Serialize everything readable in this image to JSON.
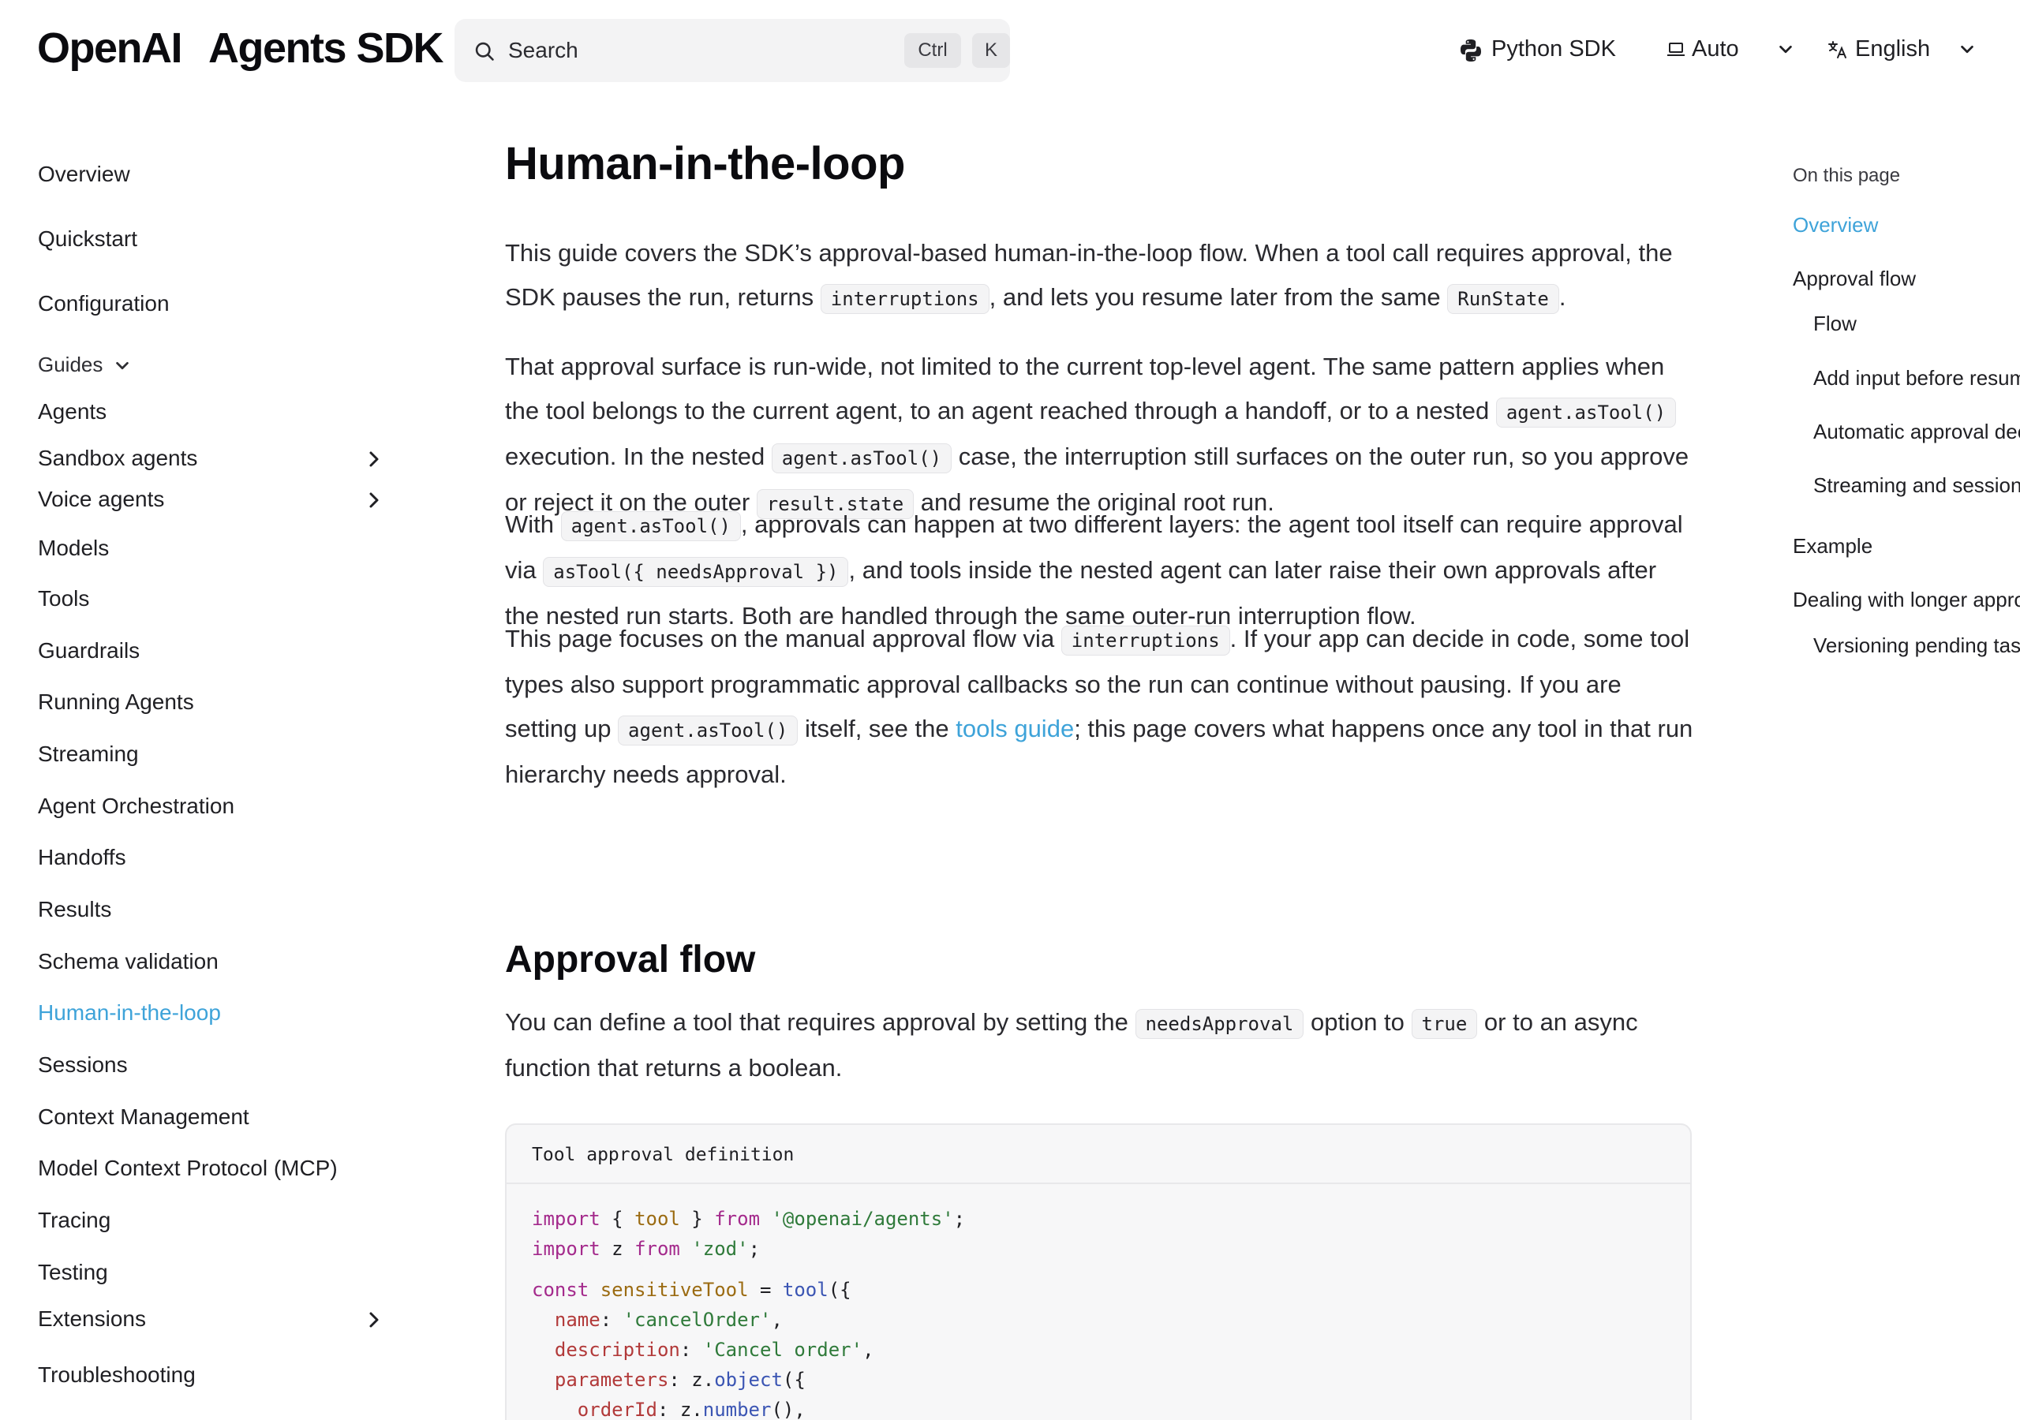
{
  "header": {
    "logo": {
      "brand": "OpenAI",
      "product": "Agents SDK"
    },
    "search": {
      "placeholder": "Search",
      "kbd_ctrl": "Ctrl",
      "kbd_k": "K"
    },
    "python_sdk": "Python SDK",
    "theme": "Auto",
    "language": "English"
  },
  "sidebar": {
    "items": [
      {
        "label": "Overview"
      },
      {
        "label": "Quickstart"
      },
      {
        "label": "Configuration"
      },
      {
        "label": "Guides"
      },
      {
        "label": "Agents"
      },
      {
        "label": "Sandbox agents"
      },
      {
        "label": "Voice agents"
      },
      {
        "label": "Models"
      },
      {
        "label": "Tools"
      },
      {
        "label": "Guardrails"
      },
      {
        "label": "Running Agents"
      },
      {
        "label": "Streaming"
      },
      {
        "label": "Agent Orchestration"
      },
      {
        "label": "Handoffs"
      },
      {
        "label": "Results"
      },
      {
        "label": "Schema validation"
      },
      {
        "label": "Human-in-the-loop"
      },
      {
        "label": "Sessions"
      },
      {
        "label": "Context Management"
      },
      {
        "label": "Model Context Protocol (MCP)"
      },
      {
        "label": "Tracing"
      },
      {
        "label": "Testing"
      },
      {
        "label": "Extensions"
      },
      {
        "label": "Troubleshooting"
      }
    ],
    "active": "Human-in-the-loop"
  },
  "main": {
    "title": "Human-in-the-loop",
    "p1": {
      "t1": "This guide covers the SDK’s approval-based human-in-the-loop flow. When a tool call requires approval, the SDK pauses the run, returns ",
      "c1": "interruptions",
      "t2": ", and lets you resume later from the same ",
      "c2": "RunState",
      "t3": "."
    },
    "p2": {
      "t1": "That approval surface is run-wide, not limited to the current top-level agent. The same pattern applies when the tool belongs to the current agent, to an agent reached through a handoff, or to a nested ",
      "c1": "agent.asTool()",
      "t2": " execution. In the nested ",
      "c2": "agent.asTool()",
      "t3": " case, the interruption still surfaces on the outer run, so you approve or reject it on the outer ",
      "c3": "result.state",
      "t4": " and resume the original root run."
    },
    "p3": {
      "t1": "With ",
      "c1": "agent.asTool()",
      "t2": ", approvals can happen at two different layers: the agent tool itself can require approval via ",
      "c2": "asTool({ needsApproval })",
      "t3": ", and tools inside the nested agent can later raise their own approvals after the nested run starts. Both are handled through the same outer-run interruption flow."
    },
    "p4": {
      "t1": "This page focuses on the manual approval flow via ",
      "c1": "interruptions",
      "t2": ". If your app can decide in code, some tool types also support programmatic approval callbacks so the run can continue without pausing. If you are setting up ",
      "c2": "agent.asTool()",
      "t3": " itself, see the ",
      "link": "tools guide",
      "t4": "; this page covers what happens once any tool in that run hierarchy needs approval."
    },
    "h2": "Approval flow",
    "p5": {
      "t1": "You can define a tool that requires approval by setting the ",
      "c1": "needsApproval",
      "t2": " option to ",
      "c2": "true",
      "t3": " or to an async function that returns a boolean."
    },
    "code": {
      "title": "Tool approval definition",
      "l1": {
        "k1": "import",
        "p1": " { ",
        "v1": "tool",
        "p2": " } ",
        "k2": "from",
        "p3": " ",
        "s1": "'@openai/agents'",
        "p4": ";"
      },
      "l2": {
        "k1": "import",
        "p1": " z ",
        "k2": "from",
        "p2": " ",
        "s1": "'zod'",
        "p3": ";"
      },
      "l3": {
        "k1": "const",
        "p1": " ",
        "v1": "sensitiveTool",
        "p2": " = ",
        "f1": "tool",
        "p3": "({"
      },
      "l4": {
        "p0": "  ",
        "pr": "name",
        "p1": ": ",
        "s1": "'cancelOrder'",
        "p2": ","
      },
      "l5": {
        "p0": "  ",
        "pr": "description",
        "p1": ": ",
        "s1": "'Cancel order'",
        "p2": ","
      },
      "l6": {
        "p0": "  ",
        "pr": "parameters",
        "p1": ": z.",
        "f1": "object",
        "p2": "({"
      },
      "l7": {
        "p0": "    ",
        "pr": "orderId",
        "p1": ": z.",
        "f1": "number",
        "p2": "(),"
      }
    }
  },
  "toc": {
    "heading": "On this page",
    "items": [
      {
        "label": "Overview"
      },
      {
        "label": "Approval flow"
      },
      {
        "label": "Flow"
      },
      {
        "label": "Add input before resuming"
      },
      {
        "label": "Automatic approval decisions"
      },
      {
        "label": "Streaming and sessions"
      },
      {
        "label": "Example"
      },
      {
        "label": "Dealing with longer approval times"
      },
      {
        "label": "Versioning pending tasks"
      }
    ]
  },
  "colors": {
    "accent": "#3ea3d9",
    "text": "#1f1f23",
    "code_bg": "#f4f4f5"
  }
}
